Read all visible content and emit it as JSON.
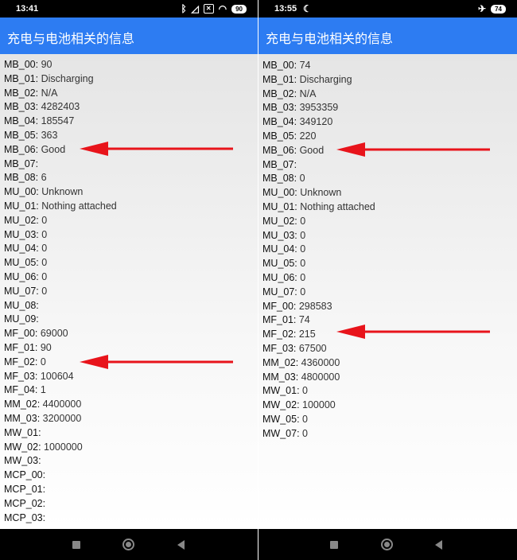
{
  "left": {
    "status": {
      "time": "13:41",
      "battery": "90"
    },
    "app_title": "充电与电池相关的信息",
    "rows": [
      {
        "key": "MB_00",
        "value": "90"
      },
      {
        "key": "MB_01",
        "value": "Discharging"
      },
      {
        "key": "MB_02",
        "value": "N/A"
      },
      {
        "key": "MB_03",
        "value": "4282403"
      },
      {
        "key": "MB_04",
        "value": "185547"
      },
      {
        "key": "MB_05",
        "value": "363"
      },
      {
        "key": "MB_06",
        "value": "Good"
      },
      {
        "key": "MB_07",
        "value": ""
      },
      {
        "key": "MB_08",
        "value": "6"
      },
      {
        "key": "MU_00",
        "value": "Unknown"
      },
      {
        "key": "MU_01",
        "value": "Nothing attached"
      },
      {
        "key": "MU_02",
        "value": "0"
      },
      {
        "key": "MU_03",
        "value": "0"
      },
      {
        "key": "MU_04",
        "value": "0"
      },
      {
        "key": "MU_05",
        "value": "0"
      },
      {
        "key": "MU_06",
        "value": "0"
      },
      {
        "key": "MU_07",
        "value": "0"
      },
      {
        "key": "MU_08",
        "value": ""
      },
      {
        "key": "MU_09",
        "value": ""
      },
      {
        "key": "MF_00",
        "value": "69000"
      },
      {
        "key": "MF_01",
        "value": "90"
      },
      {
        "key": "MF_02",
        "value": "0"
      },
      {
        "key": "MF_03",
        "value": "100604"
      },
      {
        "key": "MF_04",
        "value": "1"
      },
      {
        "key": "MM_02",
        "value": "4400000"
      },
      {
        "key": "MM_03",
        "value": "3200000"
      },
      {
        "key": "MW_01",
        "value": ""
      },
      {
        "key": "MW_02",
        "value": "1000000"
      },
      {
        "key": "MW_03",
        "value": ""
      },
      {
        "key": "MCP_00",
        "value": ""
      },
      {
        "key": "MCP_01",
        "value": ""
      },
      {
        "key": "MCP_02",
        "value": ""
      },
      {
        "key": "MCP_03",
        "value": ""
      }
    ],
    "arrow_rows": [
      "MB_06",
      "MF_02"
    ]
  },
  "right": {
    "status": {
      "time": "13:55",
      "battery": "74"
    },
    "app_title": "充电与电池相关的信息",
    "rows": [
      {
        "key": "MB_00",
        "value": "74"
      },
      {
        "key": "MB_01",
        "value": "Discharging"
      },
      {
        "key": "MB_02",
        "value": "N/A"
      },
      {
        "key": "MB_03",
        "value": "3953359"
      },
      {
        "key": "MB_04",
        "value": "349120"
      },
      {
        "key": "MB_05",
        "value": "220"
      },
      {
        "key": "MB_06",
        "value": "Good"
      },
      {
        "key": "MB_07",
        "value": ""
      },
      {
        "key": "MB_08",
        "value": "0"
      },
      {
        "key": "MU_00",
        "value": "Unknown"
      },
      {
        "key": "MU_01",
        "value": "Nothing attached"
      },
      {
        "key": "MU_02",
        "value": "0"
      },
      {
        "key": "MU_03",
        "value": "0"
      },
      {
        "key": "MU_04",
        "value": "0"
      },
      {
        "key": "MU_05",
        "value": "0"
      },
      {
        "key": "MU_06",
        "value": "0"
      },
      {
        "key": "MU_07",
        "value": "0"
      },
      {
        "key": "MF_00",
        "value": "298583"
      },
      {
        "key": "MF_01",
        "value": "74"
      },
      {
        "key": "MF_02",
        "value": "215"
      },
      {
        "key": "MF_03",
        "value": "67500"
      },
      {
        "key": "MM_02",
        "value": "4360000"
      },
      {
        "key": "MM_03",
        "value": "4800000"
      },
      {
        "key": "MW_01",
        "value": "0"
      },
      {
        "key": "MW_02",
        "value": "100000"
      },
      {
        "key": "MW_05",
        "value": "0"
      },
      {
        "key": "MW_07",
        "value": "0"
      }
    ],
    "arrow_rows": [
      "MB_06",
      "MF_02"
    ]
  },
  "colors": {
    "app_bar": "#2d7cf2",
    "arrow": "#e8141b"
  }
}
